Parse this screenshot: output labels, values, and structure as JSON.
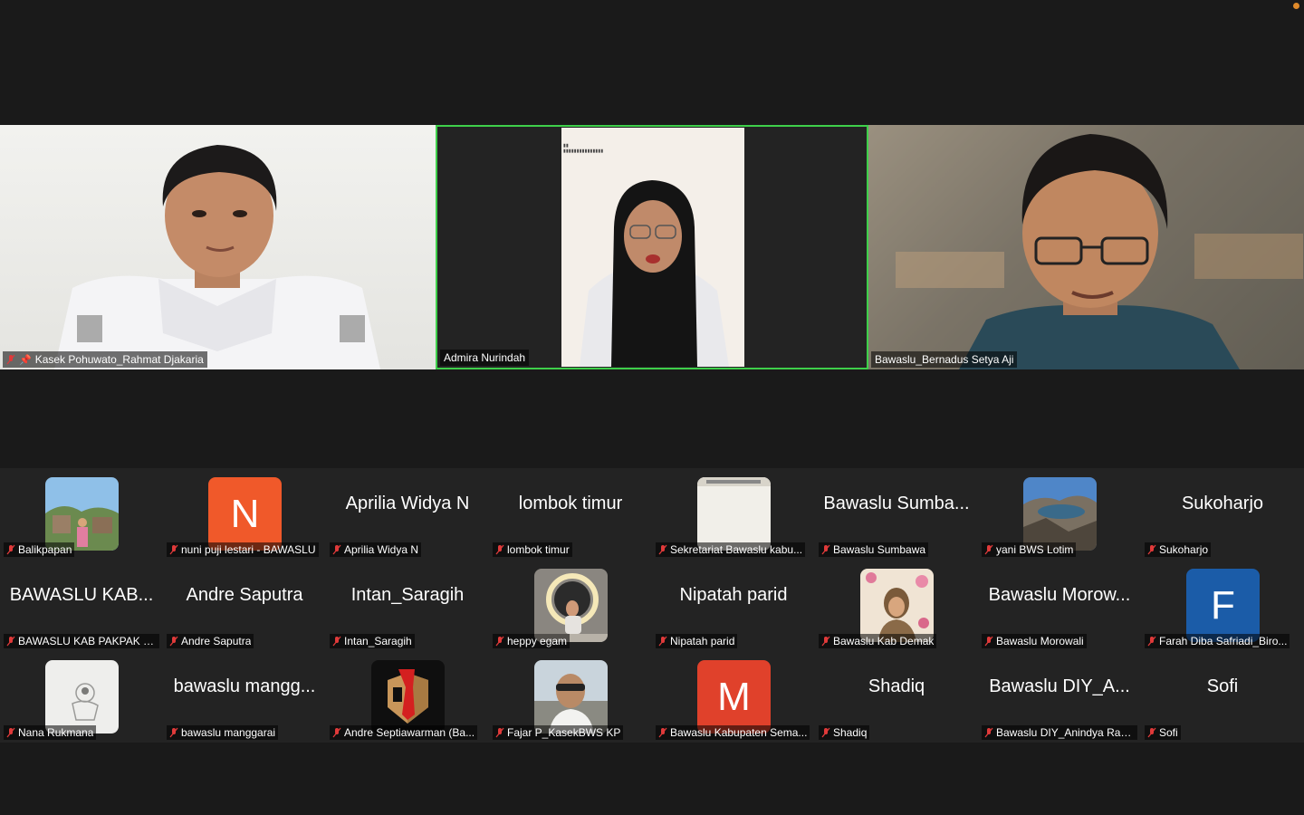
{
  "top_row": [
    {
      "name": "Kasek Pohuwato_Rahmat Djakaria",
      "muted": true,
      "pinned": true
    },
    {
      "name": "Admira Nurindah",
      "muted": false,
      "active_speaker": true
    },
    {
      "name": "Bawaslu_Bernadus Setya Aji",
      "muted": false
    }
  ],
  "gallery": [
    {
      "big": "",
      "avatar": "photo-landscape-person",
      "name": "Balikpapan"
    },
    {
      "big": "",
      "avatar_letter": "N",
      "avatar_color": "#f0592a",
      "name": "nuni puji lestari - BAWASLU"
    },
    {
      "big": "Aprilia Widya N",
      "name": "Aprilia Widya N"
    },
    {
      "big": "lombok timur",
      "name": "lombok timur"
    },
    {
      "big": "",
      "avatar": "photo-document",
      "name": "Sekretariat Bawaslu kabu..."
    },
    {
      "big": "Bawaslu Sumba...",
      "name": "Bawaslu Sumbawa"
    },
    {
      "big": "",
      "avatar": "photo-mountain",
      "name": "yani BWS Lotim"
    },
    {
      "big": "Sukoharjo",
      "name": "Sukoharjo"
    },
    {
      "big": "BAWASLU KAB...",
      "name": "BAWASLU KAB PAKPAK B..."
    },
    {
      "big": "Andre Saputra",
      "name": "Andre Saputra"
    },
    {
      "big": "Intan_Saragih",
      "name": "Intan_Saragih"
    },
    {
      "big": "",
      "avatar": "photo-ring-light",
      "name": "heppy egam"
    },
    {
      "big": "Nipatah parid",
      "name": "Nipatah parid"
    },
    {
      "big": "",
      "avatar": "photo-portrait-flowers",
      "name": "Bawaslu Kab Demak"
    },
    {
      "big": "Bawaslu Morow...",
      "name": "Bawaslu Morowali"
    },
    {
      "big": "",
      "avatar_letter": "F",
      "avatar_color": "#1b5ca8",
      "name": "Farah Diba Safriadi_Biro..."
    },
    {
      "big": "",
      "avatar": "photo-sketch",
      "name": "Nana Rukmana"
    },
    {
      "big": "bawaslu mangg...",
      "name": "bawaslu manggarai"
    },
    {
      "big": "",
      "avatar": "logo-bawaslu",
      "name": "Andre Septiawarman (Ba..."
    },
    {
      "big": "",
      "avatar": "photo-selfie",
      "name": "Fajar P_KasekBWS KP"
    },
    {
      "big": "",
      "avatar_letter": "M",
      "avatar_color": "#e0412b",
      "name": "Bawaslu Kabupaten Sema..."
    },
    {
      "big": "Shadiq",
      "name": "Shadiq"
    },
    {
      "big": "Bawaslu DIY_A...",
      "name": "Bawaslu DIY_Anindya Rac..."
    },
    {
      "big": "Sofi",
      "name": "Sofi"
    }
  ]
}
